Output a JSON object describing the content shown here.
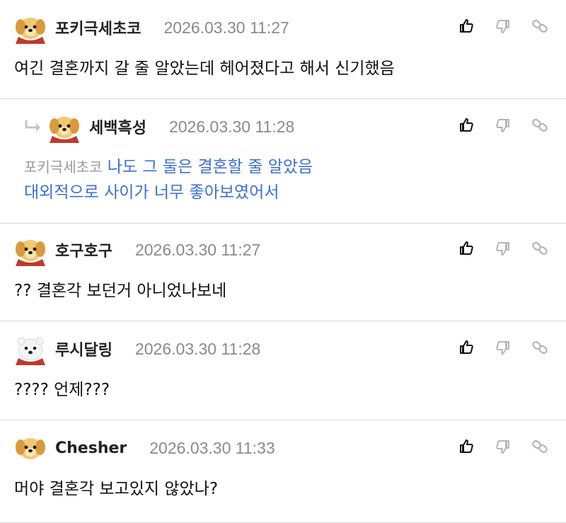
{
  "comments": [
    {
      "nickname": "포키극세초코",
      "datetime": "2026.03.30 11:27",
      "avatar": "golden-puppy-red-scarf",
      "text": "여긴 결혼까지 갈 줄 알았는데 헤어졌다고 해서 신기했음"
    },
    {
      "nickname": "호구호구",
      "datetime": "2026.03.30 11:27",
      "avatar": "golden-puppy-red-scarf",
      "text": "?? 결혼각 보던거 아니었나보네"
    },
    {
      "nickname": "루시달링",
      "datetime": "2026.03.30 11:28",
      "avatar": "white-polar-bear-red-scarf",
      "text": "???? 언제???"
    },
    {
      "nickname": "Chesher",
      "datetime": "2026.03.30 11:33",
      "avatar": "golden-puppy",
      "text": "머야 결혼각 보고있지 않았나?"
    }
  ],
  "reply": {
    "nickname": "세백흑성",
    "datetime": "2026.03.30 11:28",
    "avatar": "golden-puppy-red-scarf",
    "mention": "포키극세초코",
    "line1": "나도 그 둘은 결혼할 줄 알았음",
    "line2": "대외적으로 사이가 너무 좋아보였어서"
  },
  "icons": {
    "like": "thumbs-up-icon",
    "dislike": "thumbs-down-icon",
    "share": "link-icon",
    "reply": "reply-arrow-icon"
  },
  "colors": {
    "reply_text": "#3a6fd8",
    "timestamp": "#8a8a8a",
    "divider": "#d9d9d9"
  }
}
